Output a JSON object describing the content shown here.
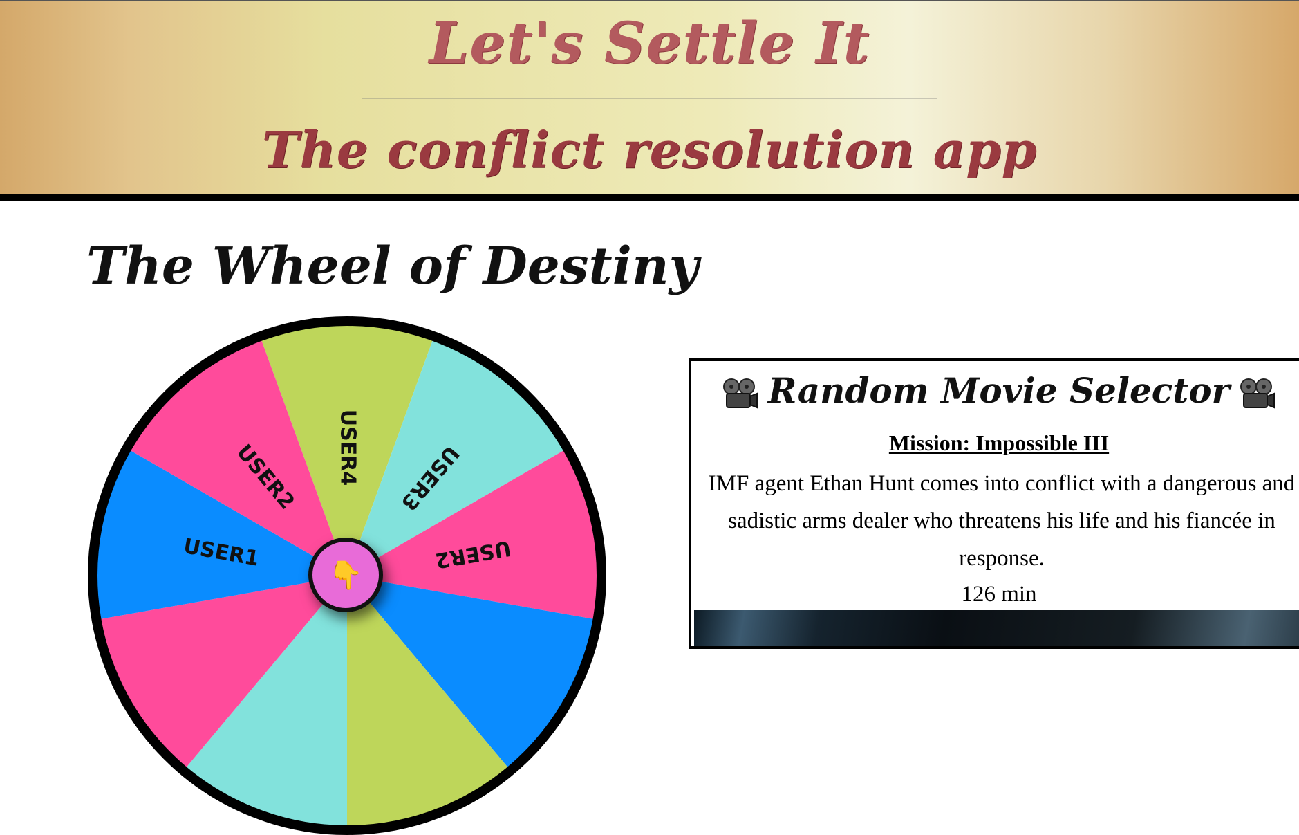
{
  "header": {
    "title": "Let's Settle It",
    "subtitle": "The conflict resolution app"
  },
  "wheel": {
    "heading": "The Wheel of Destiny",
    "spin_icon": "pointing-hand-icon",
    "segments": [
      {
        "label": "USER4",
        "color": "#bed65a"
      },
      {
        "label": "USER3",
        "color": "#82e2dc"
      },
      {
        "label": "USER2",
        "color": "#ff4b9b"
      },
      {
        "label": "",
        "color": "#0a8cff"
      },
      {
        "label": "",
        "color": "#bed65a"
      },
      {
        "label": "",
        "color": "#82e2dc"
      },
      {
        "label": "",
        "color": "#ff4b9b"
      },
      {
        "label": "USER1",
        "color": "#0a8cff"
      },
      {
        "label": "USER2",
        "color": "#ff4b9b"
      }
    ],
    "center_color": "#e86bd8"
  },
  "movie": {
    "heading": "Random Movie Selector",
    "heading_icon": "film-camera-icon",
    "title": "Mission: Impossible III",
    "description": "IMF agent Ethan Hunt comes into conflict with a dangerous and sadistic arms dealer who threatens his life and his fiancée in response.",
    "runtime": "126 min"
  }
}
